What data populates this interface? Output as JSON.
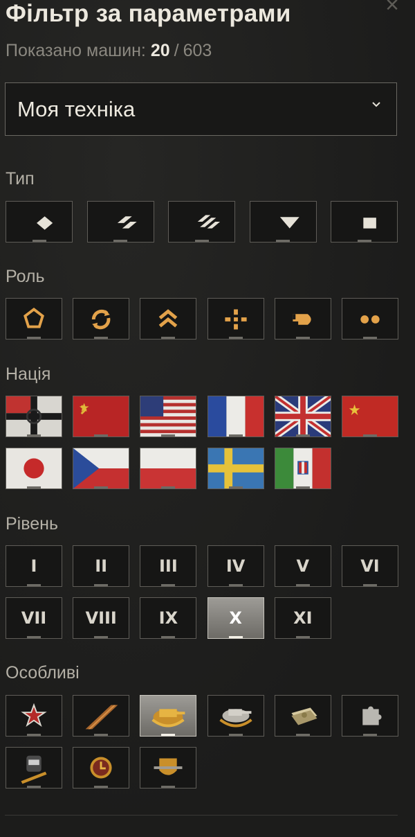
{
  "header": {
    "title": "Фільтр за параметрами",
    "shown_label": "Показано машин:",
    "shown_count": "20",
    "separator": "/",
    "total_count": "603"
  },
  "dropdown": {
    "selected": "Моя техніка"
  },
  "sections": {
    "type": "Тип",
    "role": "Роль",
    "nation": "Нація",
    "level": "Рівень",
    "special": "Особливі"
  },
  "types": [
    "light-tank-icon",
    "medium-tank-icon",
    "heavy-tank-icon",
    "tank-destroyer-icon",
    "spg-icon"
  ],
  "roles": [
    "assault-role-icon",
    "versatile-role-icon",
    "breakthrough-role-icon",
    "support-role-icon",
    "sniper-role-icon",
    "wheeled-role-icon"
  ],
  "nations": [
    "germany-flag",
    "ussr-flag",
    "usa-flag",
    "france-flag",
    "uk-flag",
    "china-flag",
    "japan-flag",
    "czech-flag",
    "poland-flag",
    "sweden-flag",
    "italy-flag"
  ],
  "levels": [
    {
      "label": "I",
      "active": false
    },
    {
      "label": "II",
      "active": false
    },
    {
      "label": "III",
      "active": false
    },
    {
      "label": "IV",
      "active": false
    },
    {
      "label": "V",
      "active": false
    },
    {
      "label": "VI",
      "active": false
    },
    {
      "label": "VII",
      "active": false
    },
    {
      "label": "VIII",
      "active": false
    },
    {
      "label": "IX",
      "active": false
    },
    {
      "label": "X",
      "active": true
    },
    {
      "label": "XI",
      "active": false
    }
  ],
  "specials": [
    "elite-star-icon",
    "premium-shell-icon",
    "premium-tank-icon",
    "collector-tank-icon",
    "rental-icon",
    "puzzle-icon",
    "crew-icon",
    "timer-icon",
    "shield-badge-icon"
  ],
  "colors": {
    "accent": "#e3a24a",
    "active_tile": "#8f8d88",
    "background": "#1f1f1e"
  }
}
